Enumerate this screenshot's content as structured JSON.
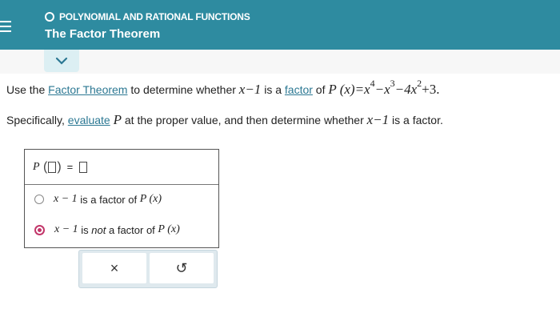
{
  "header": {
    "topic": "POLYNOMIAL AND RATIONAL FUNCTIONS",
    "title": "The Factor Theorem"
  },
  "question": {
    "line1_pre": "Use the ",
    "line1_link1": "Factor Theorem",
    "line1_mid1": " to determine whether ",
    "line1_mid2": " is a ",
    "line1_link2": "factor",
    "line1_mid3": " of ",
    "factor_expr": "x−1",
    "poly_lhs": "P (x)=x",
    "poly_exp4": "4",
    "poly_t2": "−x",
    "poly_exp3": "3",
    "poly_t3": "−4x",
    "poly_exp2": "2",
    "poly_t4": "+3.",
    "line2_pre": "Specifically, ",
    "line2_link": "evaluate",
    "line2_mid": " at the proper value, and then determine whether ",
    "line2_p": "P",
    "line2_end": " is a factor."
  },
  "answer": {
    "p_label": "P",
    "choice1_pre": "x − 1",
    "choice1_text": " is a factor of ",
    "choice1_px": "P (x)",
    "choice2_pre": "x − 1",
    "choice2_text": " is ",
    "choice2_not": "not",
    "choice2_tail": " a factor of ",
    "choice2_px": "P (x)",
    "selected": 2
  },
  "buttons": {
    "clear_symbol": "×",
    "undo_symbol": "↺"
  },
  "icons": [
    "menu-icon",
    "topic-circle-icon",
    "chevron-down-icon",
    "clear-icon",
    "undo-icon"
  ],
  "colors": {
    "header": "#2e8ba0",
    "link": "#2c7893",
    "radio_selected": "#c2366a"
  }
}
